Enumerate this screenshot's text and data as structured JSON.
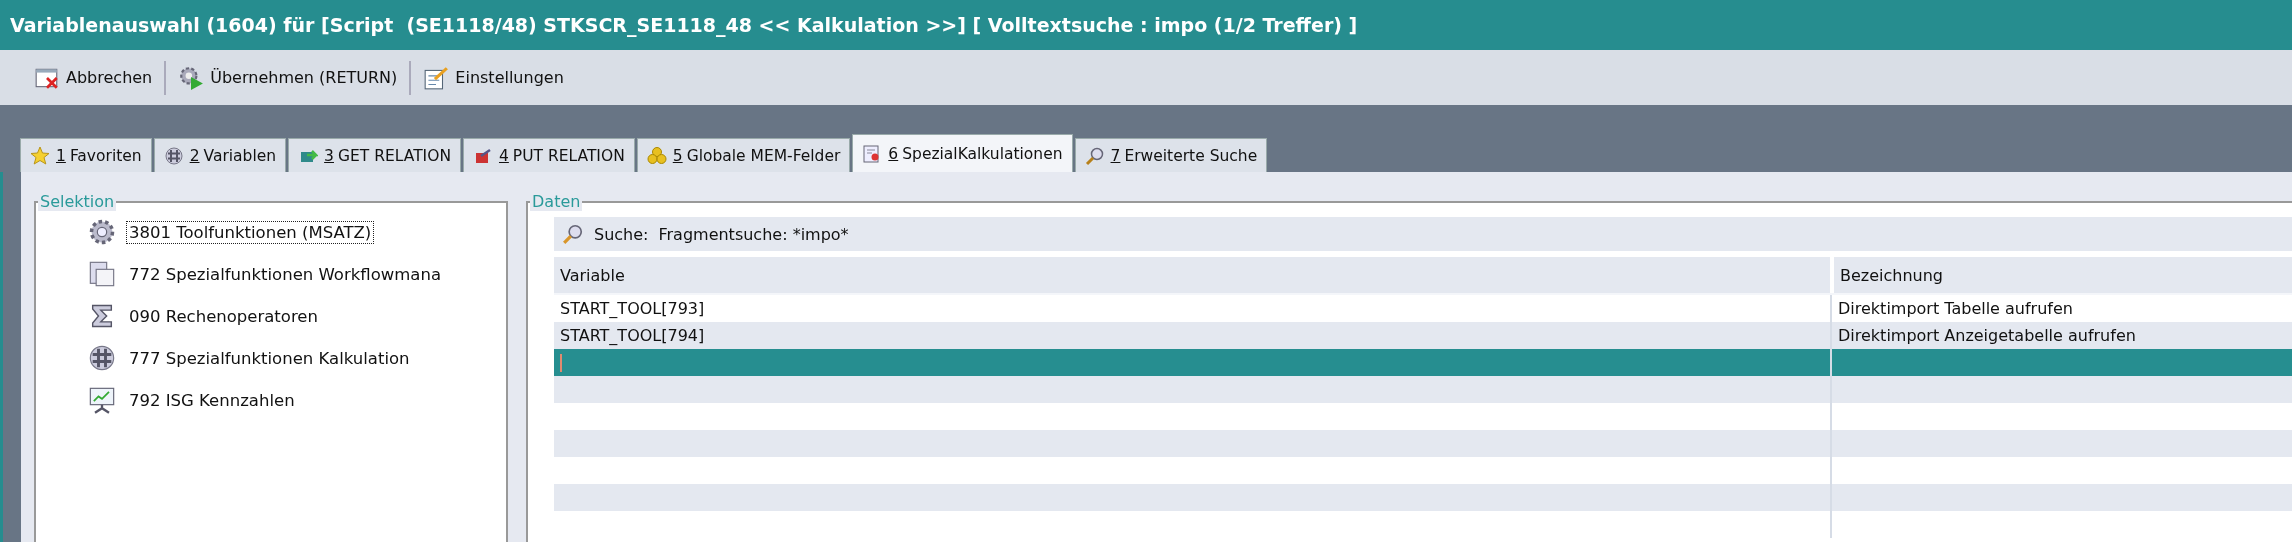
{
  "window": {
    "title": "Variablenauswahl (1604) für [Script  (SE1118/48) STKSCR_SE1118_48 << Kalkulation >>] [ Volltextsuche : impo (1/2 Treffer) ]"
  },
  "toolbar": [
    {
      "kind": "cancel",
      "label": "Abbrechen"
    },
    {
      "kind": "apply",
      "label": "Übernehmen (RETURN)"
    },
    {
      "kind": "settings",
      "label": "Einstellungen"
    }
  ],
  "tabs": [
    {
      "kind": "star",
      "key": "1",
      "label": "Favoriten",
      "selected": false
    },
    {
      "kind": "hash",
      "key": "2",
      "label": "Variablen",
      "selected": false
    },
    {
      "kind": "get",
      "key": "3",
      "label": "GET RELATION",
      "selected": false
    },
    {
      "kind": "put",
      "key": "4",
      "label": "PUT RELATION",
      "selected": false
    },
    {
      "kind": "coins",
      "key": "5",
      "label": "Globale MEM-Felder",
      "selected": false
    },
    {
      "kind": "special",
      "key": "6",
      "label": "SpezialKalkulationen",
      "selected": true
    },
    {
      "kind": "search",
      "key": "7",
      "label": "Erweiterte Suche",
      "selected": false
    }
  ],
  "selection": {
    "title": "Selektion",
    "items": [
      {
        "kind": "gear",
        "label": "3801 Toolfunktionen (MSATZ)",
        "focused": true
      },
      {
        "kind": "docs",
        "label": "772 Spezialfunktionen Workflowmana",
        "focused": false
      },
      {
        "kind": "sigma",
        "label": "090 Rechenoperatoren",
        "focused": false
      },
      {
        "kind": "hash",
        "label": "777 Spezialfunktionen Kalkulation",
        "focused": false
      },
      {
        "kind": "chart",
        "label": "792 ISG Kennzahlen",
        "focused": false
      }
    ]
  },
  "data": {
    "title": "Daten",
    "search": {
      "label": "Suche:",
      "value": "Fragmentsuche: *impo*"
    },
    "table": {
      "columns": [
        "Variable",
        "Bezeichnung"
      ],
      "rows": [
        {
          "variable": "START_TOOL[793]",
          "description": "Direktimport Tabelle aufrufen",
          "selected": false
        },
        {
          "variable": "START_TOOL[794]",
          "description": "Direktimport Anzeigetabelle aufrufen",
          "selected": false
        },
        {
          "selected": true
        }
      ]
    }
  }
}
